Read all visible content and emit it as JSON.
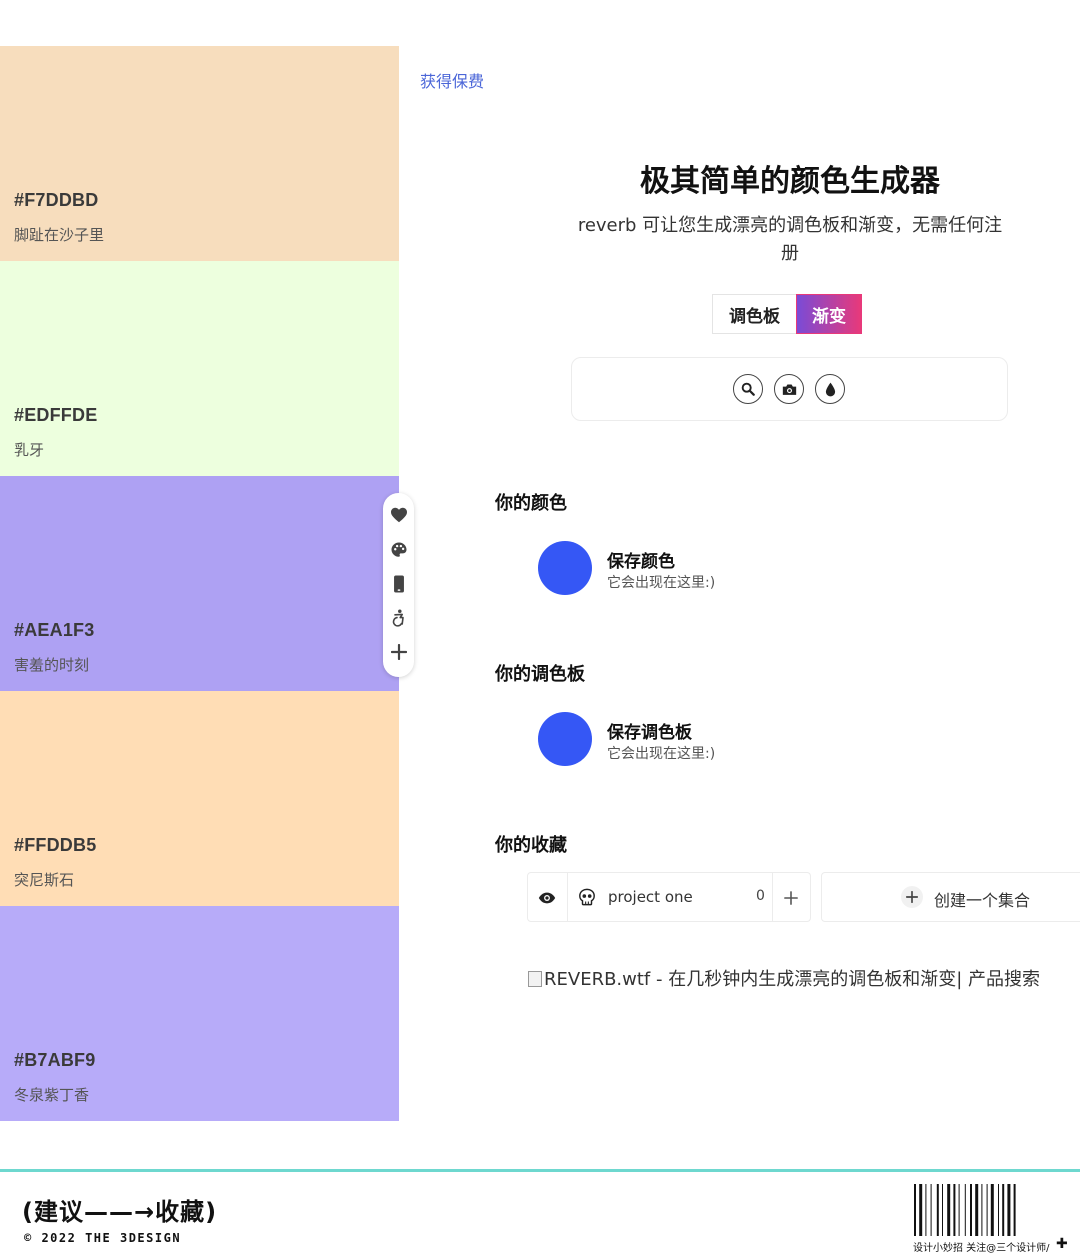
{
  "palette": {
    "swatches": [
      {
        "hex": "#F7DDBD",
        "name": "脚趾在沙子里",
        "color": "#F7DDBD"
      },
      {
        "hex": "#EDFFDE",
        "name": "乳牙",
        "color": "#EDFFDE"
      },
      {
        "hex": "#AEA1F3",
        "name": "害羞的时刻",
        "color": "#AEA1F3"
      },
      {
        "hex": "#FFDDB5",
        "name": "突尼斯石",
        "color": "#FFDDB5"
      },
      {
        "hex": "#B7ABF9",
        "name": "冬泉紫丁香",
        "color": "#B7ABF9"
      }
    ]
  },
  "side_toolbar": {
    "icons": [
      "heart-icon",
      "palette-icon",
      "phone-icon",
      "accessibility-icon",
      "plus-icon"
    ]
  },
  "header": {
    "get_pro_link": "获得保费"
  },
  "hero": {
    "title": "极其简单的颜色生成器",
    "subtitle": "reverb 可让您生成漂亮的调色板和渐变，无需任何注册"
  },
  "mode_tabs": {
    "palette_label": "调色板",
    "gradient_label": "渐变",
    "active": "渐变"
  },
  "tool_buttons": [
    "search-icon",
    "camera-icon",
    "droplet-icon"
  ],
  "your_colors": {
    "title": "你的颜色",
    "save_title": "保存颜色",
    "save_hint": "它会出现在这里:)"
  },
  "your_palettes": {
    "title": "你的调色板",
    "save_title": "保存调色板",
    "save_hint": "它会出现在这里:)"
  },
  "your_collections": {
    "title": "你的收藏",
    "project_name": "project one",
    "project_count": "0",
    "create_label": "创建一个集合"
  },
  "broken_image_alt": "REVERB.wtf - 在几秒钟内生成漂亮的调色板和渐变| 产品搜索",
  "colors": {
    "accent_blue": "#3557F5",
    "link_blue": "#4B66D8",
    "gradient_start": "#7A4BD6",
    "gradient_end": "#E8397A",
    "footer_line": "#6ED8CF"
  },
  "footer": {
    "cta": "(建议——→收藏)",
    "copyright": "© 2022 THE 3DESIGN",
    "barcode_caption": "设计小妙招  关注@三个设计师/"
  }
}
